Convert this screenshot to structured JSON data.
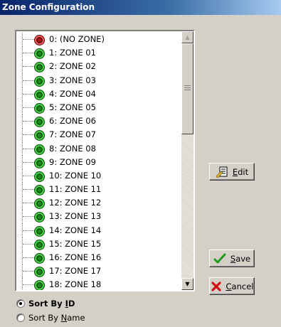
{
  "window": {
    "title": "Zone Configuration"
  },
  "zones": [
    {
      "label": "0: (NO ZONE)",
      "status": "red"
    },
    {
      "label": "1: ZONE 01",
      "status": "green"
    },
    {
      "label": "2: ZONE 02",
      "status": "green"
    },
    {
      "label": "3: ZONE 03",
      "status": "green"
    },
    {
      "label": "4: ZONE 04",
      "status": "green"
    },
    {
      "label": "5: ZONE 05",
      "status": "green"
    },
    {
      "label": "6: ZONE 06",
      "status": "green"
    },
    {
      "label": "7: ZONE 07",
      "status": "green"
    },
    {
      "label": "8: ZONE 08",
      "status": "green"
    },
    {
      "label": "9: ZONE 09",
      "status": "green"
    },
    {
      "label": "10: ZONE 10",
      "status": "green"
    },
    {
      "label": "11: ZONE 11",
      "status": "green"
    },
    {
      "label": "12: ZONE 12",
      "status": "green"
    },
    {
      "label": "13: ZONE 13",
      "status": "green"
    },
    {
      "label": "14: ZONE 14",
      "status": "green"
    },
    {
      "label": "15: ZONE 15",
      "status": "green"
    },
    {
      "label": "16: ZONE 16",
      "status": "green"
    },
    {
      "label": "17: ZONE 17",
      "status": "green"
    },
    {
      "label": "18: ZONE 18",
      "status": "green"
    }
  ],
  "buttons": {
    "edit": {
      "pre": "",
      "accel": "E",
      "post": "dit",
      "icon": "edit-document-icon"
    },
    "save": {
      "pre": "",
      "accel": "S",
      "post": "ave",
      "icon": "checkmark-icon"
    },
    "cancel": {
      "pre": "",
      "accel": "C",
      "post": "ancel",
      "icon": "x-mark-icon"
    }
  },
  "sort": {
    "by_id": {
      "pre": "Sort By ",
      "accel": "I",
      "post": "D",
      "checked": true
    },
    "by_name": {
      "pre": "Sort By ",
      "accel": "N",
      "post": "ame",
      "checked": false
    }
  },
  "colors": {
    "titlebar": "#0a246a",
    "face": "#d4d0c8",
    "status_green": "#1a8f1a",
    "status_red": "#b81212"
  }
}
